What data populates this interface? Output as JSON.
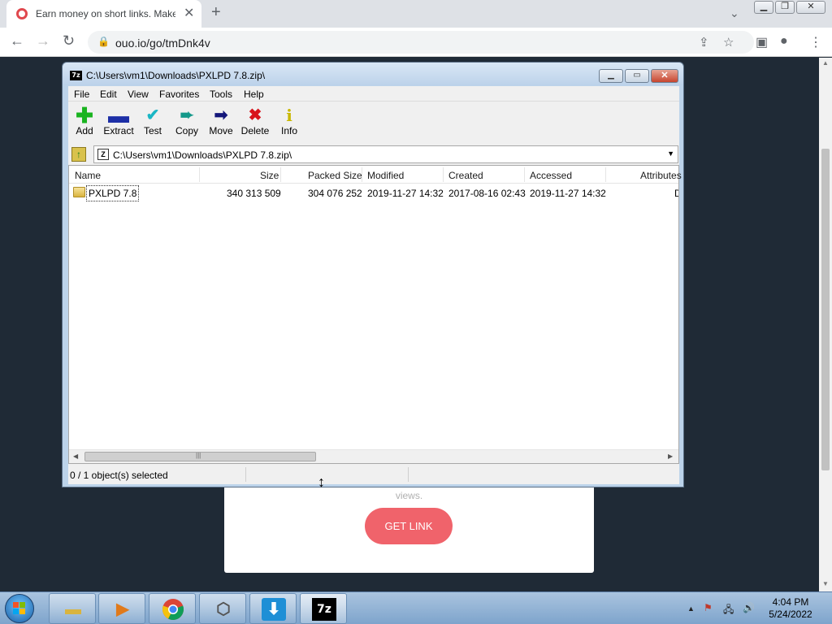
{
  "browser": {
    "tab_title": "Earn money on short links. Make",
    "url": "ouo.io/go/tmDnk4v"
  },
  "page": {
    "views_text": "views.",
    "get_link_label": "GET LINK"
  },
  "sevenzip": {
    "title": "C:\\Users\\vm1\\Downloads\\PXLPD 7.8.zip\\",
    "menu": [
      "File",
      "Edit",
      "View",
      "Favorites",
      "Tools",
      "Help"
    ],
    "toolbar": [
      {
        "label": "Add",
        "icon": "plus-icon",
        "color": "#19b31f"
      },
      {
        "label": "Extract",
        "icon": "minus-icon",
        "color": "#1d2fa6"
      },
      {
        "label": "Test",
        "icon": "check-chevron-icon",
        "color": "#1ab6c4"
      },
      {
        "label": "Copy",
        "icon": "double-arrow-icon",
        "color": "#14998a"
      },
      {
        "label": "Move",
        "icon": "arrow-right-icon",
        "color": "#13167a"
      },
      {
        "label": "Delete",
        "icon": "x-icon",
        "color": "#d8131b"
      },
      {
        "label": "Info",
        "icon": "info-icon",
        "color": "#c8b700"
      }
    ],
    "address": "C:\\Users\\vm1\\Downloads\\PXLPD 7.8.zip\\",
    "columns": [
      "Name",
      "Size",
      "Packed Size",
      "Modified",
      "Created",
      "Accessed",
      "Attributes"
    ],
    "rows": [
      {
        "name": "PXLPD 7.8",
        "size": "340 313 509",
        "packed": "304 076 252",
        "modified": "2019-11-27 14:32",
        "created": "2017-08-16 02:43",
        "accessed": "2019-11-27 14:32",
        "attributes": "D"
      }
    ],
    "status": "0 / 1 object(s) selected"
  },
  "taskbar": {
    "time": "4:04 PM",
    "date": "5/24/2022",
    "apps": [
      "file-explorer-icon",
      "media-player-icon",
      "chrome-icon",
      "box-icon",
      "download-icon",
      "sevenzip-icon"
    ],
    "sevenzip_icon_text": "7z"
  }
}
